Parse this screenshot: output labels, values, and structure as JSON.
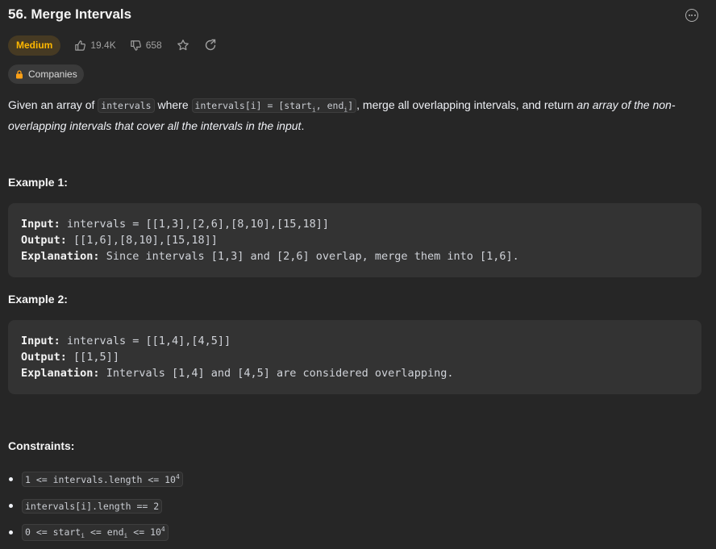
{
  "problem": {
    "title": "56. Merge Intervals",
    "difficulty": "Medium",
    "likes": "19.4K",
    "dislikes": "658",
    "companies_label": "Companies"
  },
  "description": {
    "p1": "Given an array of ",
    "code1": "intervals",
    "p2": " where ",
    "code2_a": "intervals[i] = [start",
    "code2_sub1": "i",
    "code2_b": ", end",
    "code2_sub2": "i",
    "code2_c": "]",
    "p3": ", merge all overlapping intervals, and return ",
    "em": "an array of the non-overlapping intervals that cover all the intervals in the input",
    "p4": "."
  },
  "examples": [
    {
      "heading": "Example 1:",
      "input_label": "Input:",
      "input": "intervals = [[1,3],[2,6],[8,10],[15,18]]",
      "output_label": "Output:",
      "output": "[[1,6],[8,10],[15,18]]",
      "explanation_label": "Explanation:",
      "explanation": "Since intervals [1,3] and [2,6] overlap, merge them into [1,6]."
    },
    {
      "heading": "Example 2:",
      "input_label": "Input:",
      "input": "intervals = [[1,4],[4,5]]",
      "output_label": "Output:",
      "output": "[[1,5]]",
      "explanation_label": "Explanation:",
      "explanation": "Intervals [1,4] and [4,5] are considered overlapping."
    }
  ],
  "constraints": {
    "heading": "Constraints:",
    "c1_text": "1 <= intervals.length <= 10",
    "c1_sup": "4",
    "c2_text": "intervals[i].length == 2",
    "c3_a": "0 <= start",
    "c3_sub1": "i",
    "c3_b": " <= end",
    "c3_sub2": "i",
    "c3_c": " <= 10",
    "c3_sup": "4"
  },
  "colors": {
    "background": "#262626",
    "difficulty_text": "#ffb800",
    "difficulty_bg": "#463a23",
    "code_block_bg": "#333333"
  },
  "icons": {
    "more": "more-horizontal-circle-icon",
    "like": "thumbs-up-icon",
    "dislike": "thumbs-down-icon",
    "favorite": "star-icon",
    "share": "share-icon",
    "companies": "lock-icon"
  }
}
